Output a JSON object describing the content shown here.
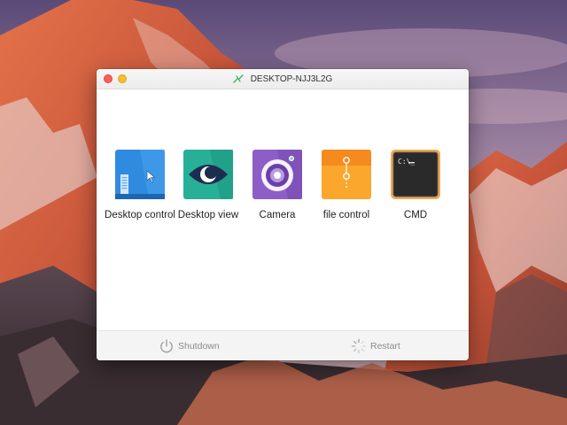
{
  "window": {
    "title": "DESKTOP-NJJ3L2G",
    "title_icon": "connection-icon",
    "controls": [
      "close",
      "minimize"
    ]
  },
  "apps": [
    {
      "label": "Desktop control",
      "icon": "desktop-control-icon",
      "color": "#2f8be0"
    },
    {
      "label": "Desktop view",
      "icon": "eye-icon",
      "color": "#27b097"
    },
    {
      "label": "Camera",
      "icon": "camera-icon",
      "color": "#8e5ec7"
    },
    {
      "label": "file control",
      "icon": "folder-icon",
      "color": "#fba62c"
    },
    {
      "label": "CMD",
      "icon": "terminal-icon",
      "color": "#2a2a2a"
    }
  ],
  "footer": {
    "shutdown_label": "Shutdown",
    "shutdown_icon": "power-icon",
    "restart_label": "Restart",
    "restart_icon": "spinner-icon"
  }
}
